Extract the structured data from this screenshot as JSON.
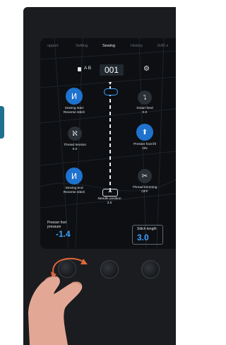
{
  "tabs": [
    {
      "label": "upport",
      "active": false
    },
    {
      "label": "Setting",
      "active": false
    },
    {
      "label": "Sewing",
      "active": true
    },
    {
      "label": "History",
      "active": false
    },
    {
      "label": "JUKI s",
      "active": false
    }
  ],
  "header": {
    "ab_label": "A B",
    "stitch_number": "001"
  },
  "controls": {
    "reverse_start": {
      "line1": "Sewing start",
      "line2": "Reverse stitch"
    },
    "smart_feed": {
      "line1": "Smart feed",
      "line2": "0.0"
    },
    "thread_tension": {
      "line1": "Thread tension",
      "line2": "0.0"
    },
    "presser_lift": {
      "line1": "Presser foot lift",
      "line2": "ON"
    },
    "reverse_end": {
      "line1": "Sewing end",
      "line2": "Reverse stitch"
    },
    "thread_trimming": {
      "line1": "Thread trimming",
      "line2": "OFF"
    },
    "needle_position": {
      "line1": "Needle position",
      "line2": "3.5"
    }
  },
  "presser_pressure": {
    "line1": "Presser foot",
    "line2": "pressure",
    "value": "-1.4"
  },
  "stitch_length": {
    "label": "Stitch length",
    "value": "3.0"
  },
  "colors": {
    "accent": "#1f73cf",
    "value_blue": "#3fa0ff",
    "screen_bg": "#0d0f12",
    "device_body": "#1b1c1f"
  },
  "icons": [
    "document-icon",
    "settings-gear-icon",
    "reverse-stitch-icon",
    "smart-feed-icon",
    "thread-tension-icon",
    "presser-lift-icon",
    "scissors-icon",
    "needle-position-icon"
  ]
}
